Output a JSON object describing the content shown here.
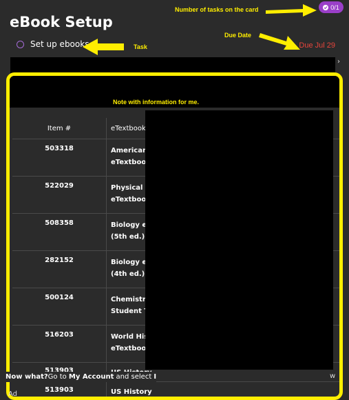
{
  "header": {
    "title": "eBook Setup"
  },
  "task": {
    "label": "Set up ebooks",
    "due": "Due Jul 29",
    "count": "0/1"
  },
  "annotations": {
    "count": "Number of tasks on the card",
    "due": "Due Date",
    "task": "Task",
    "note": "Note with information for me."
  },
  "table": {
    "headers": [
      "Item #",
      "eTextbook"
    ],
    "rows": [
      {
        "item": "503318",
        "line1": "American R",
        "line2": "eTextbook :"
      },
      {
        "item": "522029",
        "line1": "Physical Sc",
        "line2": "eTextbook :"
      },
      {
        "item": "508358",
        "line1": "Biology eTe",
        "line2": "(5th ed.)"
      },
      {
        "item": "282152",
        "line1": "Biology eTe",
        "line2": "(4th ed.)"
      },
      {
        "item": "500124",
        "line1": "Chemistry (",
        "line2": "Student Tex"
      },
      {
        "item": "516203",
        "line1": "World Histo",
        "line2": "eTextbook :"
      },
      {
        "item": "513903",
        "line1": "US History",
        "line2": ""
      },
      {
        "item": "513903",
        "line1": "US History",
        "line2": ""
      }
    ]
  },
  "footer": {
    "now_what": "Now what?",
    "goto": "Go to ",
    "my_account": "My Account",
    "and_select": " and select ",
    "select_cut": "I",
    "tail": "w",
    "more": "Ad"
  },
  "colors": {
    "accent": "#9a3fc8",
    "due": "#e8453c",
    "annotation": "#ffee00"
  },
  "icons": {
    "task": "circle-outline-icon",
    "count": "check-circle-icon"
  }
}
